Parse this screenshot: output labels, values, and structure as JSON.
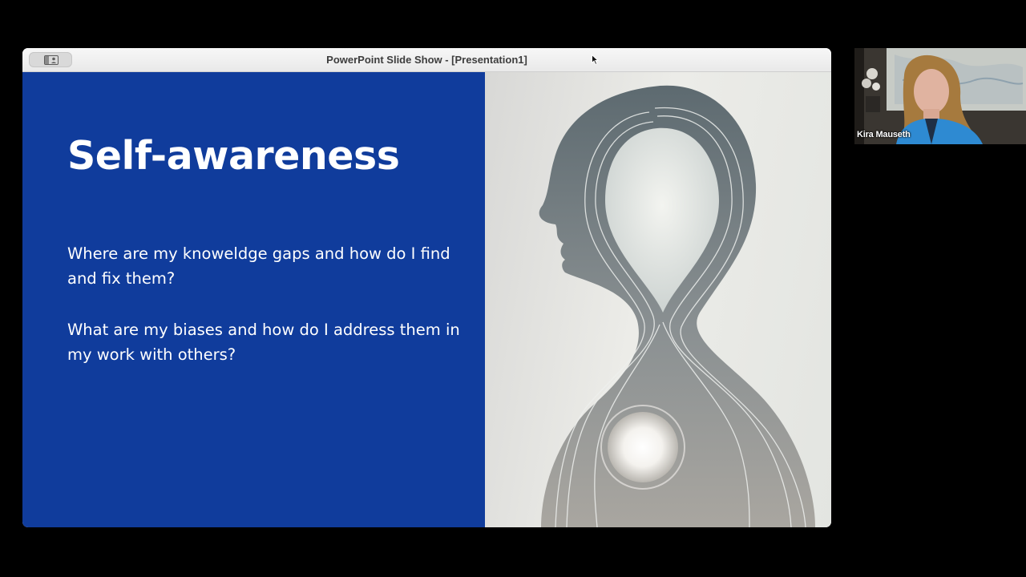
{
  "window": {
    "title": "PowerPoint Slide Show - [Presentation1]",
    "sidebar_toggle_icon": "sidebar-person-icon"
  },
  "slide": {
    "title": "Self-awareness",
    "bullets": [
      "Where are my knoweldge gaps and how do I find and fix them?",
      "What are my biases and how do I address them in my work with others?"
    ],
    "background_color": "#103c9c",
    "text_color": "#ffffff",
    "image_description_icon": "head-silhouette-illustration"
  },
  "participant": {
    "name": "Kira Mauseth"
  },
  "cursor_icon": "mouse-pointer-icon"
}
